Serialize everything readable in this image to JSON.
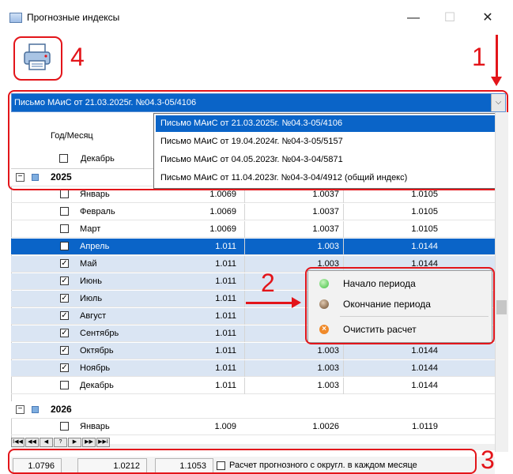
{
  "window": {
    "title": "Прогнозные индексы",
    "minimize": "—",
    "maximize": "☐",
    "close": "✕"
  },
  "toolbar": {
    "print_icon": "printer-icon"
  },
  "callouts": {
    "c1": "1",
    "c2": "2",
    "c3": "3",
    "c4": "4"
  },
  "combo": {
    "selected": "Письмо МАиС от 21.03.2025г. №04.3-05/4106",
    "arrow": "⌵",
    "options": [
      "Письмо МАиС от 21.03.2025г. №04.3-05/4106",
      "Письмо МАиС от 19.04.2024г. №04-3-05/5157",
      "Письмо МАиС от 04.05.2023г. №04-3-04/5871",
      "Письмо МАиС от 11.04.2023г. №04-3-04/4912 (общий индекс)"
    ]
  },
  "grid": {
    "header_label": "Год/Месяц",
    "header_month": "Декабрь",
    "group_2025": "2025",
    "group_2026": "2026",
    "rows": [
      {
        "month": "Январь",
        "checked": false,
        "v1": "1.0069",
        "v2": "1.0037",
        "v3": "1.0105"
      },
      {
        "month": "Февраль",
        "checked": false,
        "v1": "1.0069",
        "v2": "1.0037",
        "v3": "1.0105"
      },
      {
        "month": "Март",
        "checked": false,
        "v1": "1.0069",
        "v2": "1.0037",
        "v3": "1.0105"
      },
      {
        "month": "Апрель",
        "checked": false,
        "v1": "1.011",
        "v2": "1.003",
        "v3": "1.0144"
      },
      {
        "month": "Май",
        "checked": true,
        "v1": "1.011",
        "v2": "1.003",
        "v3": "1.0144"
      },
      {
        "month": "Июнь",
        "checked": true,
        "v1": "1.011",
        "v2": "",
        "v3": ""
      },
      {
        "month": "Июль",
        "checked": true,
        "v1": "1.011",
        "v2": "",
        "v3": ""
      },
      {
        "month": "Август",
        "checked": true,
        "v1": "1.011",
        "v2": "",
        "v3": ""
      },
      {
        "month": "Сентябрь",
        "checked": true,
        "v1": "1.011",
        "v2": "",
        "v3": ""
      },
      {
        "month": "Октябрь",
        "checked": true,
        "v1": "1.011",
        "v2": "1.003",
        "v3": "1.0144"
      },
      {
        "month": "Ноябрь",
        "checked": true,
        "v1": "1.011",
        "v2": "1.003",
        "v3": "1.0144"
      },
      {
        "month": "Декабрь",
        "checked": false,
        "v1": "1.011",
        "v2": "1.003",
        "v3": "1.0144"
      }
    ],
    "row_2026": {
      "month": "Январь",
      "checked": false,
      "v1": "1.009",
      "v2": "1.0026",
      "v3": "1.0119"
    }
  },
  "context_menu": {
    "start": "Начало периода",
    "end": "Окончание периода",
    "clear": "Очистить расчет",
    "colors": {
      "start": "#3fbf3f",
      "end": "#6b4a2a",
      "clear": "#e8731a"
    }
  },
  "nav": {
    "first": "I◀◀",
    "prev_page": "◀◀",
    "prev": "◀",
    "page": "?",
    "next": "▶",
    "next_page": "▶▶",
    "last": "▶▶I"
  },
  "footer": {
    "total1": "1.0796",
    "total2": "1.0212",
    "total3": "1.1053",
    "round_label": "Расчет прогнозного с округл. в каждом месяце"
  },
  "accent": "#0a64c8",
  "callout_color": "#e3151a"
}
